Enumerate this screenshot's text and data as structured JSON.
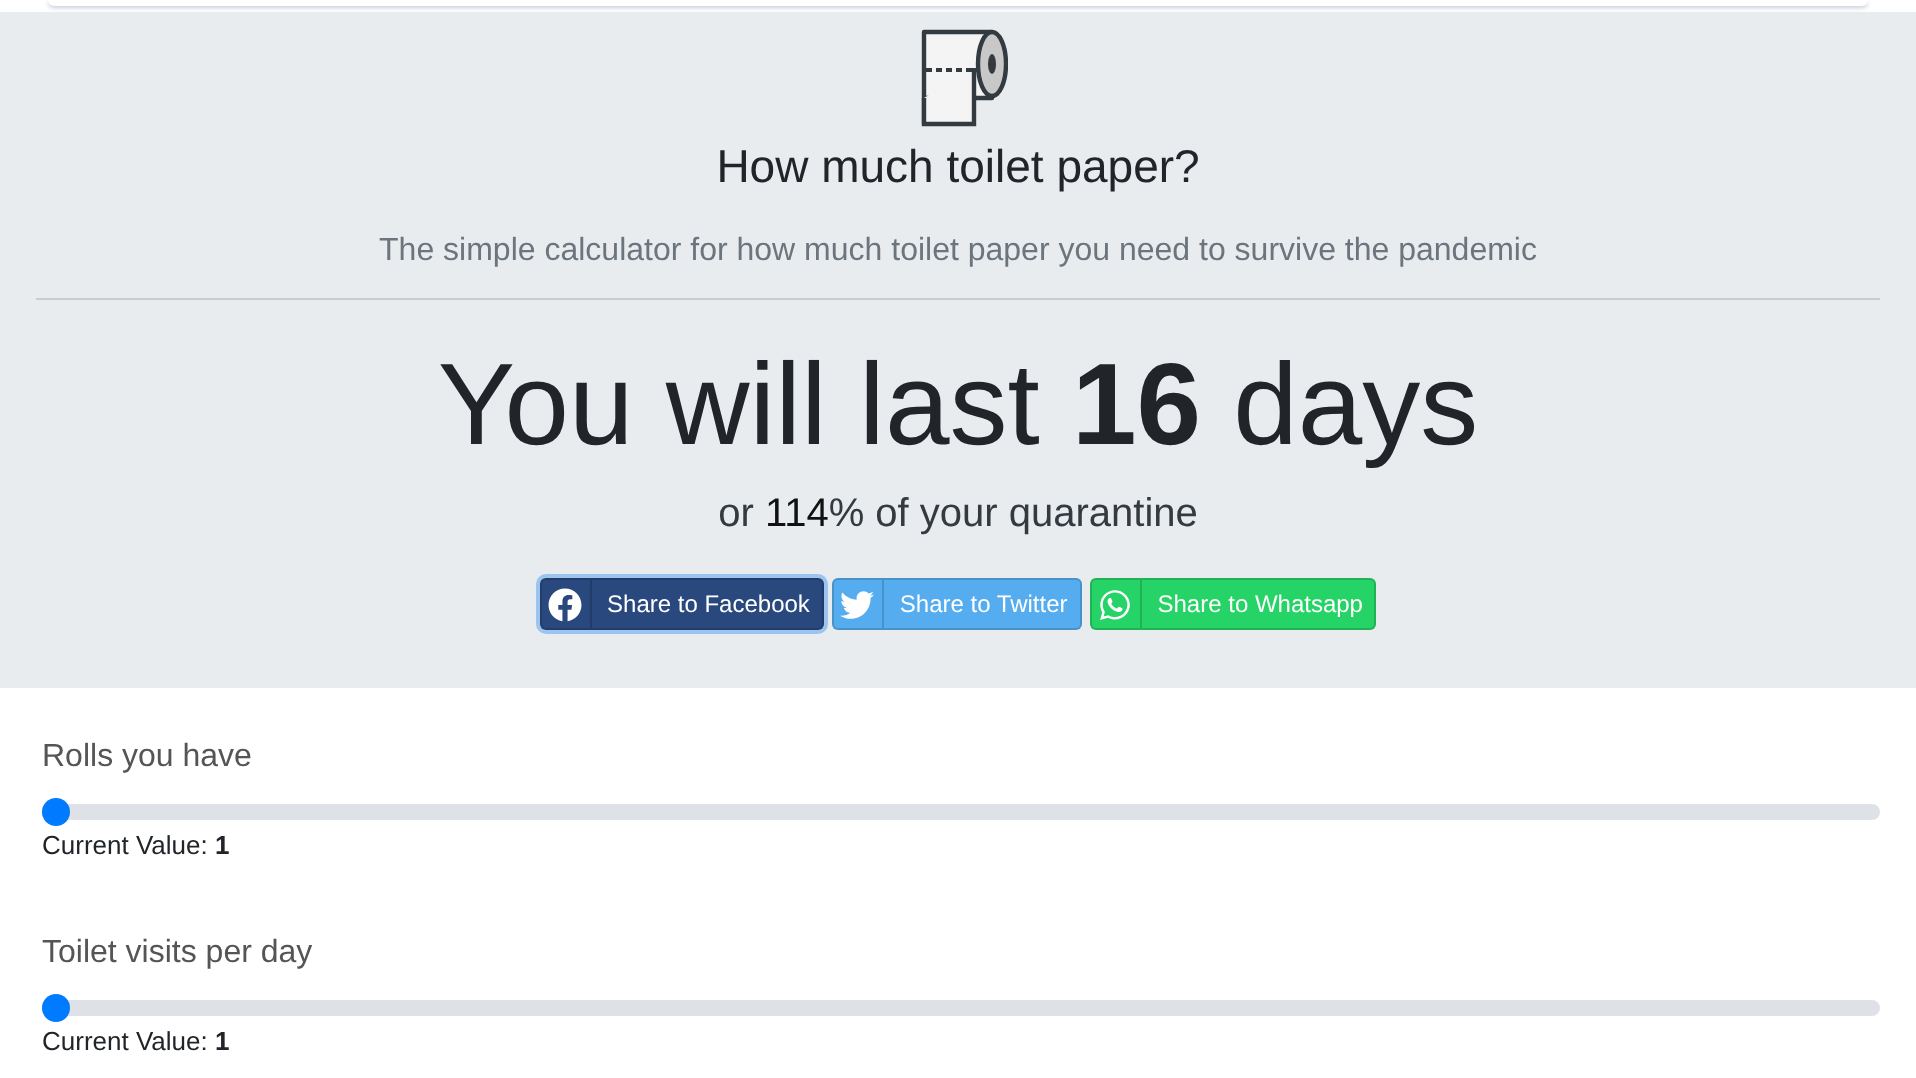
{
  "header": {
    "title": "How much toilet paper?",
    "subtitle": "The simple calculator for how much toilet paper you need to survive the pandemic"
  },
  "result": {
    "headline": "You will last **16** days",
    "detail": "or **114**% of your quarantine"
  },
  "share_buttons": [
    {
      "kind": "facebook",
      "label": "Share to Facebook",
      "selected": true
    },
    {
      "kind": "twitter",
      "label": "Share to Twitter",
      "selected": false
    },
    {
      "kind": "whatsapp",
      "label": "Share to Whatsapp",
      "selected": false
    }
  ],
  "sliders": [
    {
      "label": "Rolls you have",
      "level": 0,
      "value_label": "Current Value:",
      "value": "1"
    },
    {
      "label": "Toilet visits per day",
      "level": 0,
      "value_label": "Current Value:",
      "value": "1"
    }
  ]
}
